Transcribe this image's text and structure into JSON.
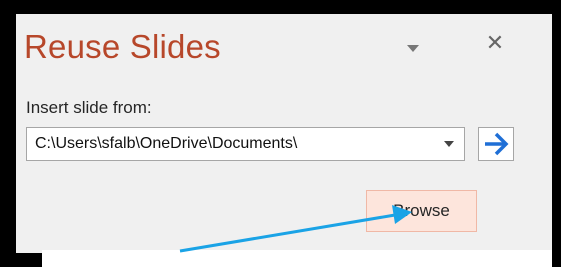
{
  "pane": {
    "title": "Reuse Slides",
    "menu_icon": "chevron-down-icon",
    "close_icon": "close-icon",
    "close_glyph": "✕"
  },
  "insert": {
    "label": "Insert slide from:",
    "path_value": "C:\\Users\\sfalb\\OneDrive\\Documents\\",
    "dropdown_icon": "chevron-down-icon",
    "go_icon": "arrow-right-icon",
    "browse_label": "Browse"
  },
  "colors": {
    "title": "#b7472a",
    "arrow_icon": "#1f6fd6",
    "annotation_arrow": "#1aa3e6",
    "browse_hover": "#fde5dc"
  }
}
